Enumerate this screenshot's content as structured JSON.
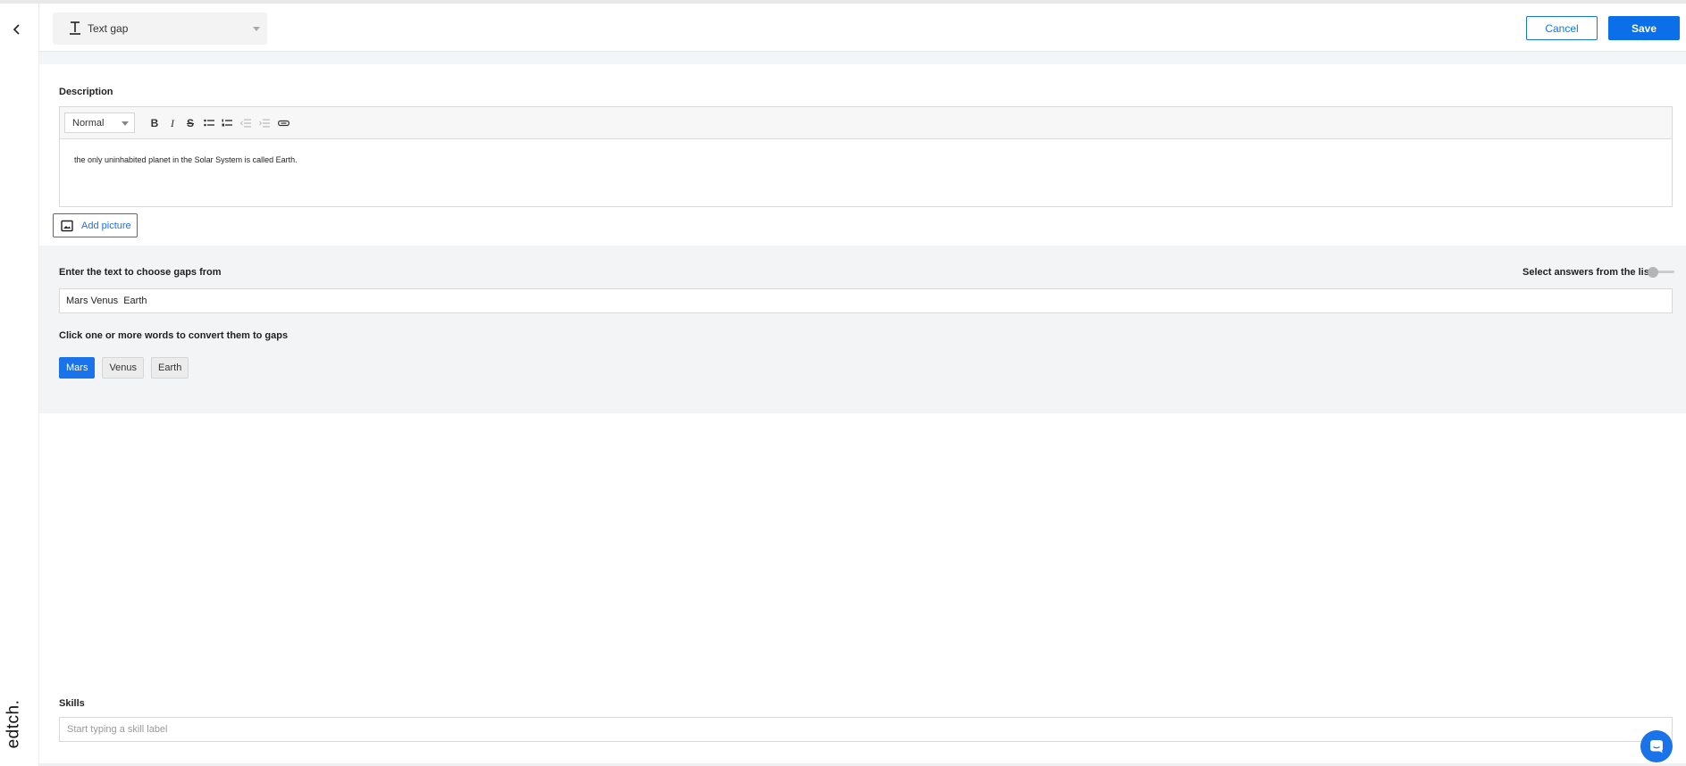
{
  "header": {
    "question_type": "Text gap",
    "cancel_label": "Cancel",
    "save_label": "Save"
  },
  "sidebar": {
    "brand": "edtch."
  },
  "description": {
    "title": "Description",
    "format_value": "Normal",
    "toolbar_icons": [
      "bold-icon",
      "italic-icon",
      "strikethrough-icon",
      "bullet-list-icon",
      "numbered-list-icon",
      "outdent-icon",
      "indent-icon",
      "link-icon"
    ],
    "body": "the only uninhabited planet in the Solar System is called Earth.",
    "add_picture_label": "Add picture"
  },
  "gaps": {
    "source_title": "Enter the text to choose gaps from",
    "source_text": "Mars Venus  Earth",
    "toggle_label": "Select answers from the list",
    "toggle_on": false,
    "words_title": "Click one or more words to convert them to gaps",
    "words": [
      {
        "text": "Mars",
        "selected": true
      },
      {
        "text": "Venus",
        "selected": false
      },
      {
        "text": "Earth",
        "selected": false
      }
    ]
  },
  "skills": {
    "title": "Skills",
    "placeholder": "Start typing a skill label"
  },
  "colors": {
    "accent": "#1a73e8",
    "panel": "#f3f4f5"
  }
}
